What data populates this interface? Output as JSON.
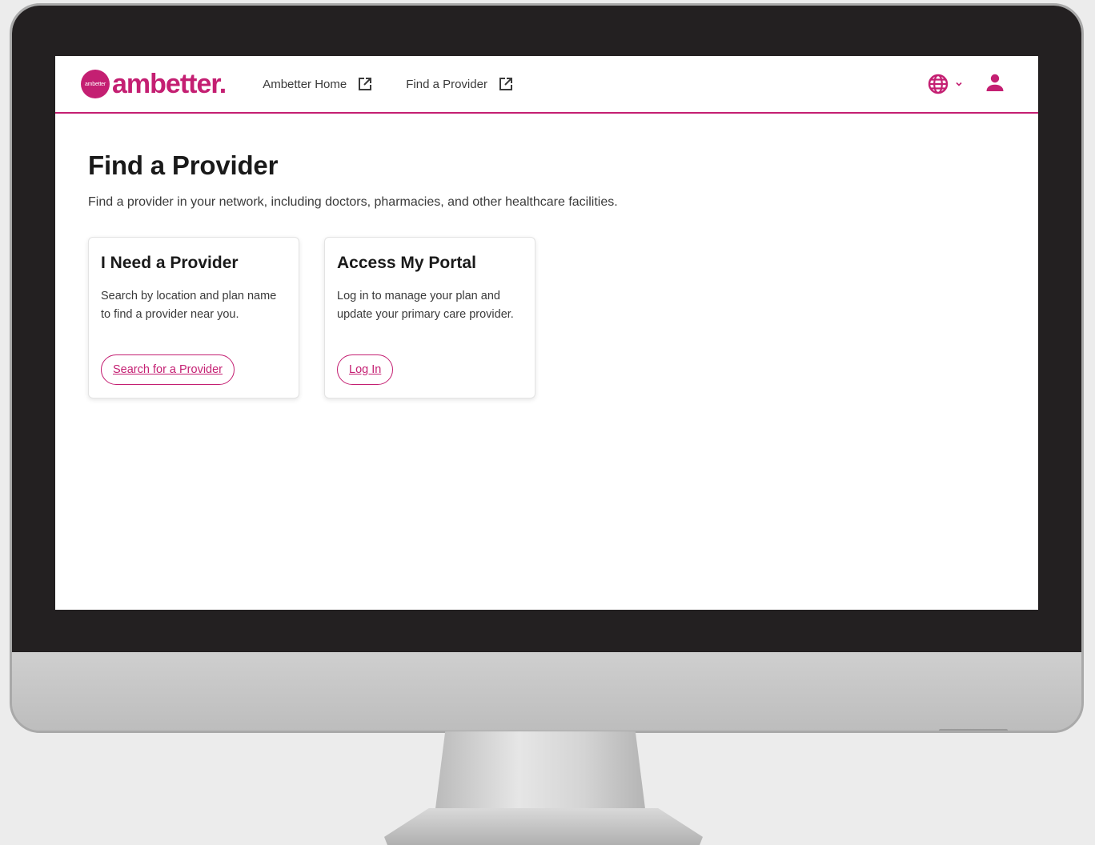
{
  "brand": {
    "logo_small": "ambetter",
    "logo_text": "ambetter.",
    "accent": "#c41f72"
  },
  "nav": {
    "links": [
      {
        "label": "Ambetter Home",
        "icon": "external-link-icon"
      },
      {
        "label": "Find a Provider",
        "icon": "external-link-icon"
      }
    ],
    "language_icon": "globe-icon",
    "account_icon": "user-icon"
  },
  "main": {
    "title": "Find a Provider",
    "description": "Find a provider in your network, including doctors, pharmacies, and other healthcare facilities.",
    "cards": [
      {
        "title": "I Need a Provider",
        "text": "Search by location and plan name to find a provider near you.",
        "button": "Search for a Provider"
      },
      {
        "title": "Access My Portal",
        "text": "Log in to manage your plan and update your primary care provider.",
        "button": "Log In"
      }
    ]
  }
}
